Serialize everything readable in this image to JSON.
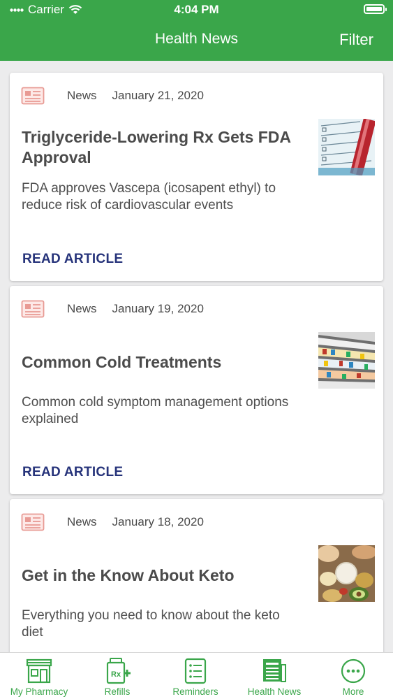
{
  "status_bar": {
    "carrier": "Carrier",
    "time": "4:04 PM"
  },
  "header": {
    "title": "Health News",
    "filter_label": "Filter"
  },
  "colors": {
    "brand_green": "#3aa64a",
    "link_navy": "#26337a",
    "icon_red": "#e89a94"
  },
  "articles": [
    {
      "type": "News",
      "date": "January 21, 2020",
      "title": "Triglyceride-Lowering Rx Gets FDA Approval",
      "description": "FDA approves Vascepa (icosapent ethyl) to reduce risk of cardiovascular events",
      "action": "READ ARTICLE",
      "thumb_icon": "lipid-profile-form-image"
    },
    {
      "type": "News",
      "date": "January 19, 2020",
      "title": "Common Cold Treatments",
      "description": "Common cold symptom management options explained",
      "action": "READ ARTICLE",
      "thumb_icon": "pharmacy-shelves-image"
    },
    {
      "type": "News",
      "date": "January 18, 2020",
      "title": "Get in the Know About Keto",
      "description": "Everything you need to know about the keto diet",
      "thumb_icon": "keto-diet-foods-image"
    }
  ],
  "tabs": [
    {
      "label": "My Pharmacy",
      "icon": "pharmacy-store-icon"
    },
    {
      "label": "Refills",
      "icon": "rx-refill-icon"
    },
    {
      "label": "Reminders",
      "icon": "checklist-icon"
    },
    {
      "label": "Health News",
      "icon": "newspaper-icon"
    },
    {
      "label": "More",
      "icon": "more-dots-icon"
    }
  ]
}
